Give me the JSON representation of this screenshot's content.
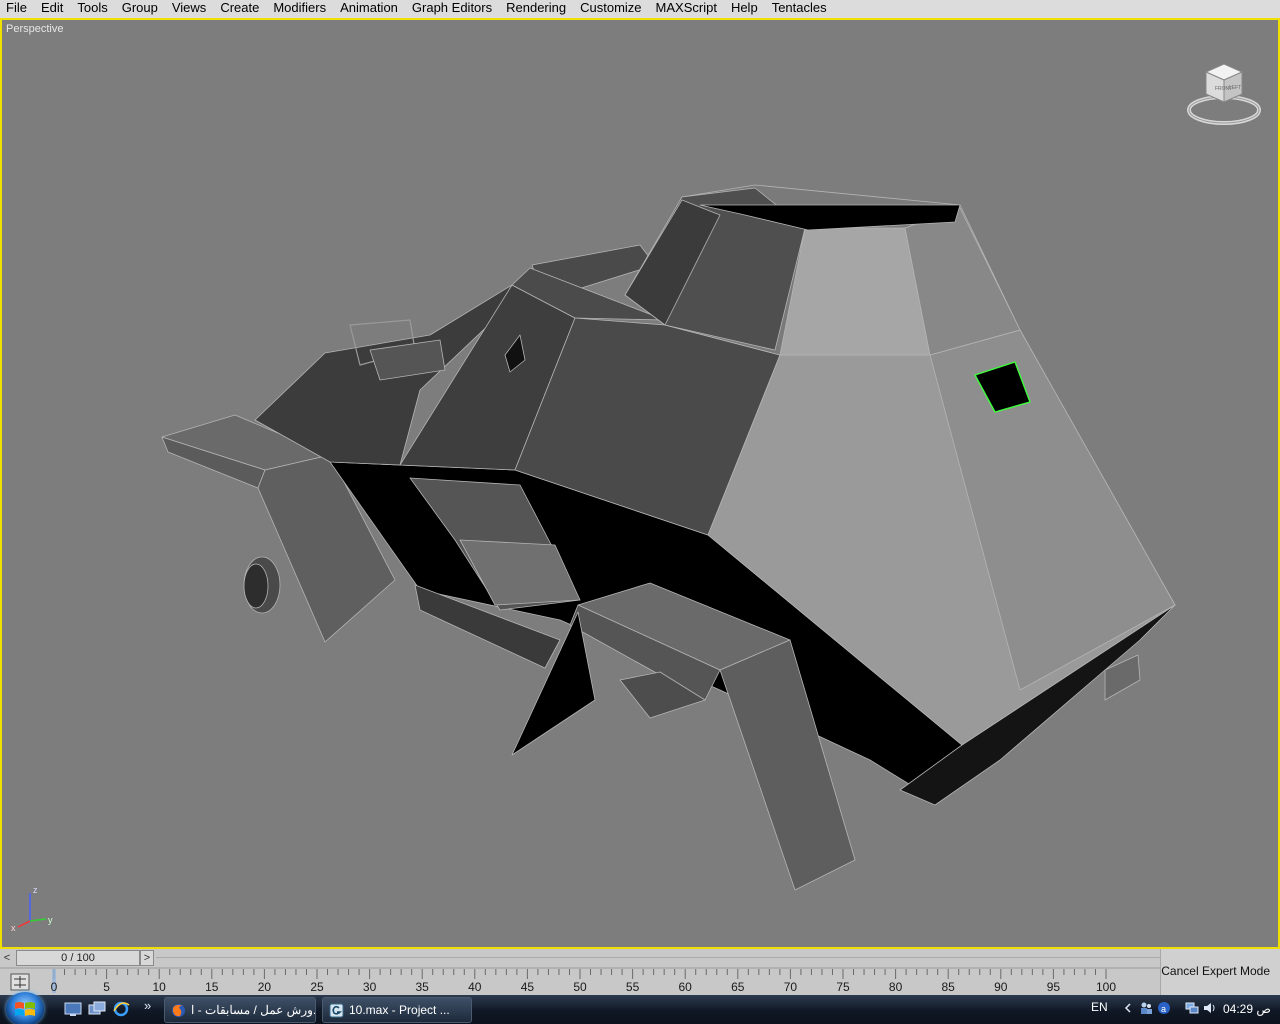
{
  "menu": [
    "File",
    "Edit",
    "Tools",
    "Group",
    "Views",
    "Create",
    "Modifiers",
    "Animation",
    "Graph Editors",
    "Rendering",
    "Customize",
    "MAXScript",
    "Help",
    "Tentacles"
  ],
  "viewport": {
    "label": "Perspective",
    "viewcube": {
      "face_front": "FRONT",
      "face_right": "LEFT"
    },
    "axis": {
      "x": "x",
      "y": "y",
      "z": "z"
    },
    "colors": {
      "background": "#7d7d7d",
      "active_border": "#f0e000",
      "selection": "#3cff3c"
    }
  },
  "timeslider": {
    "value": "0 / 100",
    "prev": "<",
    "next": ">"
  },
  "trackbar": {
    "ticks": [
      "0",
      "5",
      "10",
      "15",
      "20",
      "25",
      "30",
      "35",
      "40",
      "45",
      "50",
      "55",
      "60",
      "65",
      "70",
      "75",
      "80",
      "85",
      "90",
      "95",
      "100"
    ]
  },
  "status": {
    "cancel_expert": "Cancel Expert Mode"
  },
  "taskbar": {
    "quicklaunch_more": "»",
    "tasks": [
      {
        "label": "ورش عمل / مسابقات - ا...",
        "icon": "firefox-icon"
      },
      {
        "label": "10.max     - Project ...",
        "icon": "3dsmax-icon"
      }
    ],
    "tray": {
      "language": "EN",
      "clock": "04:29 ص"
    }
  }
}
